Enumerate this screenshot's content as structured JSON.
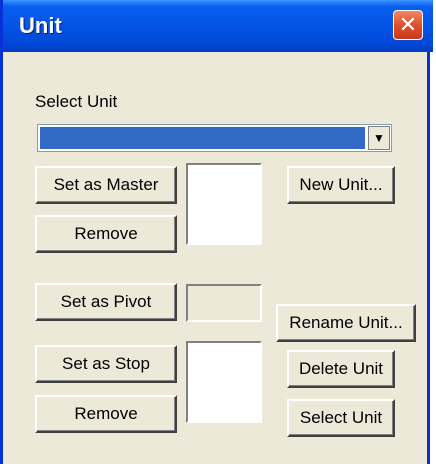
{
  "window": {
    "title": "Unit",
    "close_glyph": "✕"
  },
  "select_unit_label": "Select Unit",
  "unit_combo": {
    "selected_value": "",
    "arrow_glyph": "▼"
  },
  "buttons": {
    "set_as_master": "Set as Master",
    "remove_master": "Remove",
    "new_unit": "New Unit...",
    "set_as_pivot": "Set as Pivot",
    "rename_unit": "Rename Unit...",
    "set_as_stop": "Set as Stop",
    "delete_unit": "Delete Unit",
    "remove_stop": "Remove",
    "select_unit": "Select Unit"
  },
  "colors": {
    "title_bar": "#0453e6",
    "close_button": "#e2542e",
    "selection": "#316ac5",
    "face": "#ece9d8"
  }
}
